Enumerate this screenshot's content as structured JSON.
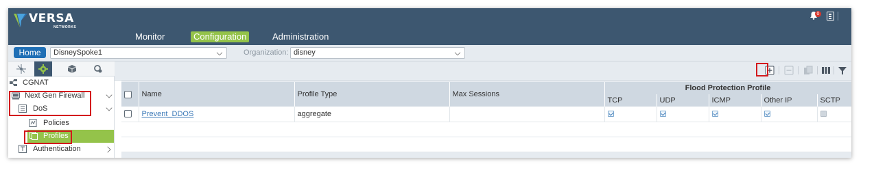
{
  "header": {
    "brand": "VERSA",
    "brand_sub": "NETWORKS",
    "nav": [
      "Monitor",
      "Configuration",
      "Administration"
    ],
    "notification_count": "0"
  },
  "context": {
    "home_label": "Home",
    "appliance_value": "DisneySpoke1",
    "org_label": "Organization:",
    "org_value": "disney"
  },
  "sidebar": {
    "tabs": [
      "network-tab",
      "configuration-tab",
      "objects-tab",
      "settings-tab"
    ],
    "items": [
      {
        "label": "CGNAT"
      },
      {
        "label": "Next Gen Firewall"
      },
      {
        "label": "DoS"
      },
      {
        "label": "Policies"
      },
      {
        "label": "Profiles"
      },
      {
        "label": "Authentication"
      }
    ]
  },
  "toolbar": {
    "buttons": [
      "add",
      "remove",
      "clone",
      "columns",
      "filter"
    ]
  },
  "grid": {
    "columns": [
      "Name",
      "Profile Type",
      "Max Sessions"
    ],
    "group_header": "Flood Protection Profile",
    "sub_columns": [
      "TCP",
      "UDP",
      "ICMP",
      "Other IP",
      "SCTP"
    ],
    "rows": [
      {
        "name": "Prevent_DDOS",
        "profile_type": "aggregate",
        "max_sessions": "",
        "tcp": true,
        "udp": true,
        "icmp": true,
        "other_ip": true,
        "sctp": false
      }
    ]
  },
  "colors": {
    "header_bg": "#3d5770",
    "accent_green": "#94c34a",
    "home_blue": "#1f6fb5",
    "highlight_red": "#d3191d"
  }
}
